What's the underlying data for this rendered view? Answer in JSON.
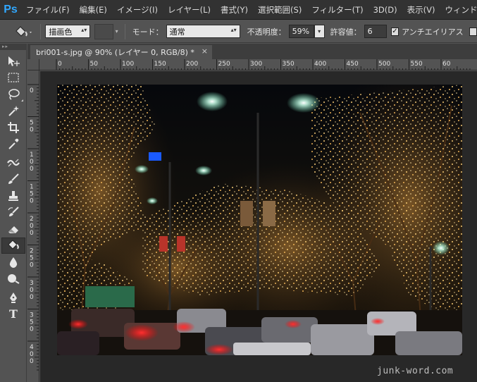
{
  "app": {
    "logo": "Ps"
  },
  "menu": [
    "ファイル(F)",
    "編集(E)",
    "イメージ(I)",
    "レイヤー(L)",
    "書式(Y)",
    "選択範囲(S)",
    "フィルター(T)",
    "3D(D)",
    "表示(V)",
    "ウィンドウ"
  ],
  "options": {
    "tool_icon": "paint-bucket-icon",
    "fill_source": "描画色",
    "mode_label": "モード：",
    "mode_value": "通常",
    "opacity_label": "不透明度：",
    "opacity_value": "59%",
    "tolerance_label": "許容値：",
    "tolerance_value": "6",
    "antialias_label": "アンチエイリアス",
    "antialias_checked": "✓"
  },
  "document": {
    "tab_title": "bri001-s.jpg @ 90% (レイヤー 0, RGB/8) *",
    "close_glyph": "×"
  },
  "rulers": {
    "h_labels": [
      "0",
      "50",
      "100",
      "150",
      "200",
      "250",
      "300",
      "350",
      "400",
      "450",
      "500",
      "550",
      "60"
    ],
    "v_labels": [
      "0",
      "50",
      "100",
      "150",
      "200",
      "250",
      "300",
      "350",
      "400"
    ]
  },
  "tools": [
    {
      "name": "move-tool",
      "icon": "move-icon"
    },
    {
      "name": "marquee-tool",
      "icon": "rectangular-marquee-icon"
    },
    {
      "name": "lasso-tool",
      "icon": "lasso-icon"
    },
    {
      "name": "magic-wand-tool",
      "icon": "magic-wand-icon"
    },
    {
      "name": "crop-tool",
      "icon": "crop-icon"
    },
    {
      "name": "eyedropper-tool",
      "icon": "eyedropper-icon"
    },
    {
      "name": "healing-tool",
      "icon": "healing-brush-icon"
    },
    {
      "name": "brush-tool",
      "icon": "brush-icon"
    },
    {
      "name": "clone-stamp-tool",
      "icon": "clone-stamp-icon"
    },
    {
      "name": "history-brush-tool",
      "icon": "history-brush-icon"
    },
    {
      "name": "eraser-tool",
      "icon": "eraser-icon"
    },
    {
      "name": "paint-bucket-tool",
      "icon": "paint-bucket-icon",
      "active": true
    },
    {
      "name": "blur-tool",
      "icon": "blur-drop-icon"
    },
    {
      "name": "dodge-tool",
      "icon": "dodge-icon"
    },
    {
      "name": "pen-tool",
      "icon": "pen-icon"
    },
    {
      "name": "type-tool",
      "icon": "type-icon",
      "glyph": "T"
    }
  ],
  "colors": {
    "accent": "#31a8ff",
    "menubar_bg": "#323232",
    "panel_bg": "#535353",
    "canvas_bg": "#282828"
  },
  "footer": {
    "watermark": "junk-word.com"
  }
}
